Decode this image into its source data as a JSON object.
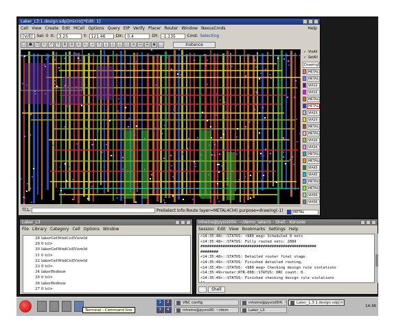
{
  "main_window": {
    "title": "Laker_L3:1.design:sdp||micro||*Edit: 1]",
    "menu": [
      "Cell",
      "View",
      "Create",
      "Edit",
      "MCell",
      "Options",
      "Query",
      "EIP",
      "Verify",
      "Placer",
      "Router",
      "Window",
      "NexusCmds"
    ],
    "help": "Help",
    "coords": {
      "mode": "[V/E]",
      "sel_label": "Sel: 0",
      "x_label": "X:",
      "x_value": "3.25",
      "y_label": "Y:",
      "y_value": "121.46",
      "dx_label": "DX:",
      "dx_value": "0.4",
      "dy_label": "DY:",
      "dy_value": "-1.135",
      "cmd_label": "Cmd:",
      "cmd_value": "Selecting"
    },
    "instance_button": "Instance",
    "tcl_label": "TCL:",
    "status": "PreSelect Info:Route layer=METAL4(34) purpose=drawing(-1)",
    "current_layer": "METAL",
    "layer_panel": {
      "visibility": [
        "VisAll",
        "SelAll"
      ],
      "drawing_set": "DrawingSet",
      "layers": [
        {
          "name": "METAL1",
          "color": "#ff6a6a"
        },
        {
          "name": "METAL1",
          "color": "#6f7cff"
        },
        {
          "name": "VIA12",
          "color": "#8b008b"
        },
        {
          "name": "VIA12",
          "color": "#ff00ff"
        },
        {
          "name": "METAL2",
          "color": "#d2691e"
        },
        {
          "name": "METAL2",
          "color": "#1e3cff"
        },
        {
          "name": "VIA23",
          "color": "#b0c4de"
        },
        {
          "name": "VIA23",
          "color": "#ffd700"
        },
        {
          "name": "METAL3",
          "color": "#a0522d"
        },
        {
          "name": "METAL3",
          "color": "#ffb6c1"
        },
        {
          "name": "VIA34",
          "color": "#9acd32"
        },
        {
          "name": "VIA34",
          "color": "#ee82ee"
        },
        {
          "name": "METAL4",
          "color": "#20b2aa"
        },
        {
          "name": "METAL4",
          "color": "#ff8c00"
        },
        {
          "name": "VIA45",
          "color": "#228b22"
        },
        {
          "name": "VIA45",
          "color": "#00ced1"
        },
        {
          "name": "METAL5",
          "color": "#6495ed"
        },
        {
          "name": "METAL5",
          "color": "#7fff00"
        },
        {
          "name": "VIA56",
          "color": "#90ee90"
        },
        {
          "name": "VIA56",
          "color": "#708090"
        }
      ],
      "selected_index": 5
    }
  },
  "small_window": {
    "title": "Laker_L3",
    "menu": [
      "File",
      "Library",
      "Category",
      "Cell",
      "Options",
      "Window"
    ],
    "lines": [
      {
        "n": "28",
        "t": "lakerGetWndCellViewId"
      },
      {
        "n": "29",
        "t": "0 tcl>"
      },
      {
        "n": "30",
        "t": "lakerGetWndCellViewId"
      },
      {
        "n": "31",
        "t": "0 tcl>"
      },
      {
        "n": "32",
        "t": "lakerGetWndCellViewId"
      },
      {
        "n": "33",
        "t": "0 tcl>"
      },
      {
        "n": "34",
        "t": "lakerRedraw"
      },
      {
        "n": "35",
        "t": "0 tcl>"
      },
      {
        "n": "36",
        "t": "lakerRedraw"
      },
      {
        "n": "37",
        "t": "0 tcl>"
      }
    ]
  },
  "konsole": {
    "title": "mheins@pyxis004: ~/demo_laker/s - Shell - Konsole",
    "menu": [
      "Session",
      "Edit",
      "View",
      "Bookmarks",
      "Settings",
      "Help"
    ],
    "lines": [
      "<14:35:48>::STATUS: <980 meg> Scheduled 0 nets",
      "<14:35:48>::STATUS: Fully routed nets: 2084",
      "####################################################",
      "########",
      "<14:35:48>::STATUS: Detailed router final stage.",
      "<14:35:49>::STATUS: Finished detailed routing.",
      "<14:35:49>::STATUS: <980 meg> Checking design rule violations",
      "<14:35:49>router:RTR-008::STATUS: DRC count: 0.",
      "<14:35:49>::STATUS: Finished checking design rule violations",
      "[]"
    ],
    "tab_new": "",
    "tab_shell": "Shell"
  },
  "taskbar": {
    "tooltip": "Terminal - Command line",
    "pager": [
      "1",
      "2",
      "3",
      "4"
    ],
    "tasks": [
      "VNC config",
      "mheins@pyxis004: ~/dem",
      "Laker_1.3:1.design:sdp[m",
      "mheins@pyxis00: ~/dem",
      "Laker_L3"
    ],
    "clock": "14:36"
  }
}
